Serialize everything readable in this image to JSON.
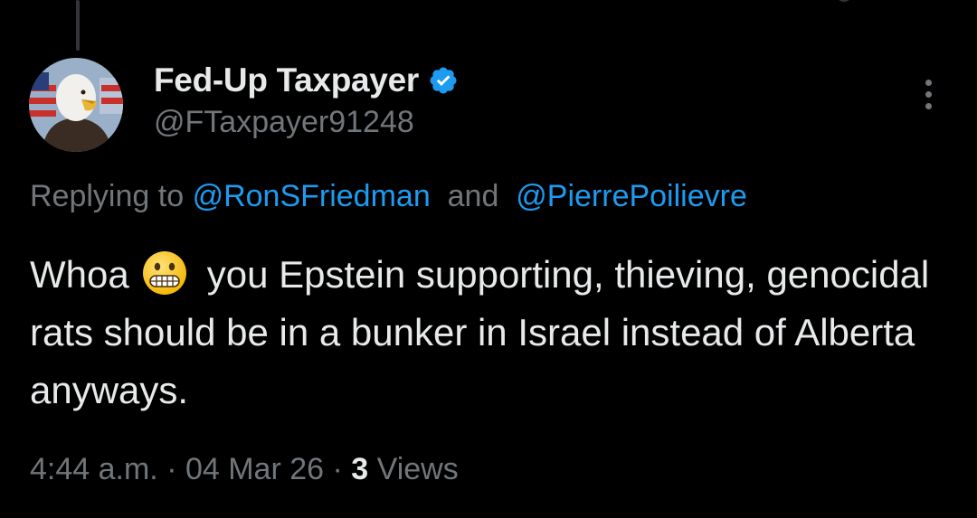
{
  "tweet": {
    "display_name": "Fed-Up Taxpayer",
    "handle": "@FTaxpayer91248",
    "verified": true,
    "replying_prefix": "Replying to",
    "reply_mentions": [
      "@RonSFriedman",
      "@PierrePoilievre"
    ],
    "reply_joiner": " and ",
    "text_before_emoji": "Whoa",
    "emoji": "grimacing-face",
    "text_after_emoji": "you Epstein supporting, thieving, genocidal rats should be in a bunker in Israel instead of Alberta anyways.",
    "time": "4:44 a.m.",
    "date": "04 Mar 26",
    "separator": " · ",
    "views_count": "3",
    "views_label": " Views"
  },
  "icons": {
    "verified": "verified-badge-icon",
    "more": "more-options-icon",
    "avatar": "bald-eagle-flag-avatar"
  },
  "colors": {
    "background": "#000000",
    "primary_text": "#e7e9ea",
    "secondary_text": "#71767b",
    "link": "#1d9bf0",
    "verified_badge": "#1d9bf0"
  }
}
